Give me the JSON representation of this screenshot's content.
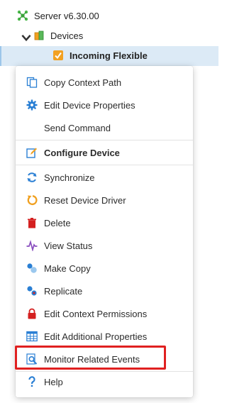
{
  "tree": {
    "server_label": "Server v6.30.00",
    "devices_label": "Devices",
    "selected_device_label": "Incoming Flexible"
  },
  "menu": {
    "items": [
      {
        "label": "Copy Context Path",
        "icon": "copy-document-icon"
      },
      {
        "label": "Edit Device Properties",
        "icon": "gear-icon"
      },
      {
        "label": "Send Command",
        "icon": "none"
      },
      {
        "label": "Configure Device",
        "icon": "edit-pencil-icon"
      },
      {
        "label": "Synchronize",
        "icon": "sync-icon"
      },
      {
        "label": "Reset Device Driver",
        "icon": "reset-icon"
      },
      {
        "label": "Delete",
        "icon": "trash-icon"
      },
      {
        "label": "View Status",
        "icon": "pulse-icon"
      },
      {
        "label": "Make Copy",
        "icon": "make-copy-icon"
      },
      {
        "label": "Replicate",
        "icon": "replicate-icon"
      },
      {
        "label": "Edit Context Permissions",
        "icon": "lock-icon"
      },
      {
        "label": "Edit Additional Properties",
        "icon": "table-icon"
      },
      {
        "label": "Monitor Related Events",
        "icon": "search-document-icon"
      },
      {
        "label": "Help",
        "icon": "help-icon"
      }
    ]
  },
  "colors": {
    "selection_bg": "#dceaf6",
    "highlight_border": "#e02020",
    "icon_blue": "#2a7fd4",
    "icon_orange": "#f0a020",
    "icon_red": "#d42020"
  }
}
